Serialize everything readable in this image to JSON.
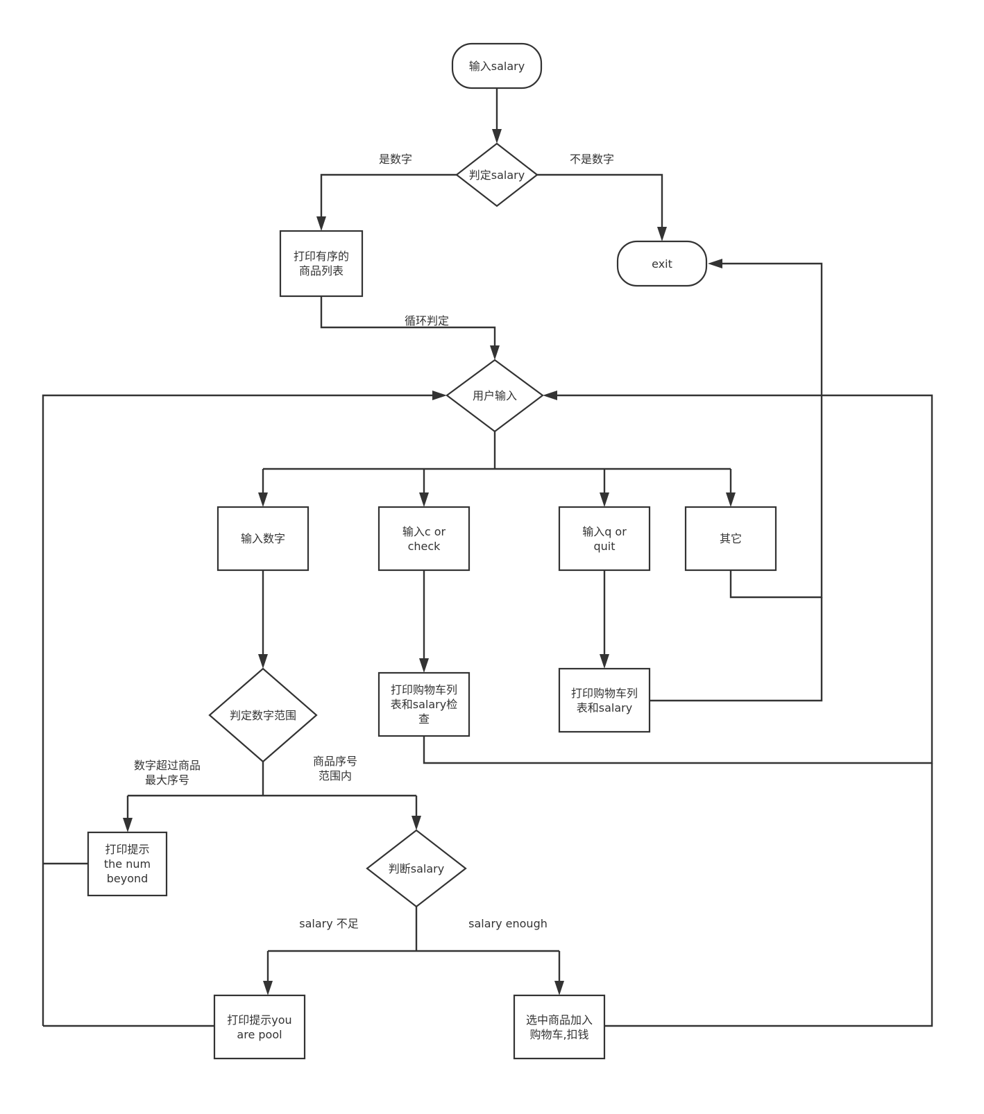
{
  "diagram": {
    "type": "flowchart",
    "nodes": {
      "start": {
        "shape": "terminator",
        "label": "输入salary"
      },
      "check_salary": {
        "shape": "decision",
        "label": "判定salary"
      },
      "print_list": {
        "shape": "process",
        "label": "打印有序的\n商品列表"
      },
      "exit": {
        "shape": "terminator",
        "label": "exit"
      },
      "user_input": {
        "shape": "decision",
        "label": "用户输入"
      },
      "input_number": {
        "shape": "process",
        "label": "输入数字"
      },
      "input_check": {
        "shape": "process",
        "label": "输入c or\ncheck"
      },
      "input_quit": {
        "shape": "process",
        "label": "输入q or\nquit"
      },
      "other": {
        "shape": "process",
        "label": "其它"
      },
      "check_range": {
        "shape": "decision",
        "label": "判定数字范围"
      },
      "print_cart_check": {
        "shape": "process",
        "label": "打印购物车列\n表和salary检\n查"
      },
      "print_cart_salary": {
        "shape": "process",
        "label": "打印购物车列\n表和salary"
      },
      "print_beyond": {
        "shape": "process",
        "label": "打印提示\nthe num\nbeyond"
      },
      "judge_salary": {
        "shape": "decision",
        "label": "判断salary"
      },
      "print_poor": {
        "shape": "process",
        "label": "打印提示you\nare pool"
      },
      "add_to_cart": {
        "shape": "process",
        "label": "选中商品加入\n购物车,扣钱"
      }
    },
    "edge_labels": {
      "is_number": "是数字",
      "not_number": "不是数字",
      "loop_check": "循环判定",
      "exceeds_max": "数字超过商品\n最大序号",
      "in_range": "商品序号\n范围内",
      "salary_insufficient": "salary 不足",
      "salary_enough": "salary enough"
    },
    "edges": [
      {
        "from": "start",
        "to": "check_salary"
      },
      {
        "from": "check_salary",
        "to": "print_list",
        "label": "是数字"
      },
      {
        "from": "check_salary",
        "to": "exit",
        "label": "不是数字"
      },
      {
        "from": "print_list",
        "to": "user_input",
        "label": "循环判定"
      },
      {
        "from": "user_input",
        "to": "input_number"
      },
      {
        "from": "user_input",
        "to": "input_check"
      },
      {
        "from": "user_input",
        "to": "input_quit"
      },
      {
        "from": "user_input",
        "to": "other"
      },
      {
        "from": "other",
        "to": "exit"
      },
      {
        "from": "input_number",
        "to": "check_range"
      },
      {
        "from": "input_check",
        "to": "print_cart_check"
      },
      {
        "from": "input_quit",
        "to": "print_cart_salary"
      },
      {
        "from": "print_cart_salary",
        "to": "exit"
      },
      {
        "from": "print_cart_check",
        "to": "user_input"
      },
      {
        "from": "check_range",
        "to": "print_beyond",
        "label": "数字超过商品最大序号"
      },
      {
        "from": "check_range",
        "to": "judge_salary",
        "label": "商品序号范围内"
      },
      {
        "from": "print_beyond",
        "to": "user_input"
      },
      {
        "from": "judge_salary",
        "to": "print_poor",
        "label": "salary 不足"
      },
      {
        "from": "judge_salary",
        "to": "add_to_cart",
        "label": "salary enough"
      },
      {
        "from": "print_poor",
        "to": "user_input"
      },
      {
        "from": "add_to_cart",
        "to": "user_input"
      }
    ]
  }
}
